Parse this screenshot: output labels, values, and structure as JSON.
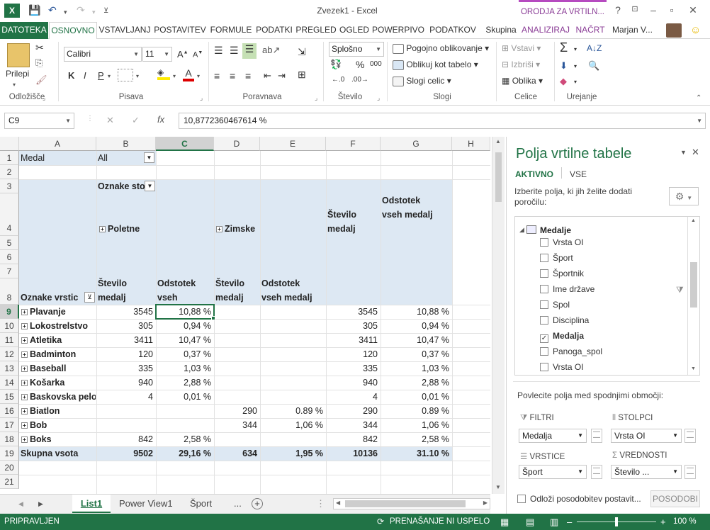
{
  "titlebar": {
    "app_icon": "X",
    "title": "Zvezek1 - Excel",
    "context_tab": "ORODJA ZA VRTILN...",
    "help": "?",
    "minimize": "–",
    "restore": "▫",
    "close": "✕"
  },
  "tabs": [
    "DATOTEKA",
    "OSNOVNO",
    "VSTAVLJANJ",
    "POSTAVITEV",
    "FORMULE",
    "PODATKI",
    "PREGLED",
    "OGLED",
    "POWERPIVO",
    "PODATKOV",
    "Skupina",
    "ANALIZIRAJ",
    "NAČRT"
  ],
  "user": "Marjan V...",
  "ribbon": {
    "clipboard": {
      "paste": "Prilepi",
      "label": "Odložišče"
    },
    "font": {
      "name": "Calibri",
      "size": "11",
      "bold": "K",
      "italic": "I",
      "underline": "P",
      "label": "Pisava"
    },
    "alignment": {
      "label": "Poravnava"
    },
    "number": {
      "format": "Splošno",
      "percent": "%",
      "comma": "000",
      "label": "Število"
    },
    "styles": {
      "cond": "Pogojno oblikovanje",
      "table": "Oblikuj kot tabelo",
      "cell": "Slogi celic",
      "label": "Slogi"
    },
    "cells": {
      "insert": "Vstavi",
      "delete": "Izbriši",
      "format": "Oblika",
      "label": "Celice"
    },
    "editing": {
      "label": "Urejanje"
    }
  },
  "formula_bar": {
    "name_box": "C9",
    "cancel": "✕",
    "enter": "✓",
    "fx": "fx",
    "value": "10,8772360467614 %"
  },
  "columns": [
    "A",
    "B",
    "C",
    "D",
    "E",
    "F",
    "G",
    "H"
  ],
  "rows": [
    "1",
    "2",
    "3",
    "4",
    "5",
    "6",
    "7",
    "8",
    "9",
    "10",
    "11",
    "12",
    "13",
    "14",
    "15",
    "16",
    "17",
    "18",
    "19",
    "20",
    "21"
  ],
  "pivot": {
    "filter_label": "Medal",
    "filter_value": "All",
    "col_labels": "Oznake sto",
    "row_labels": "Oznake vrstic",
    "group1": "Poletne",
    "group2": "Zimske",
    "total_count_hdr_1": "Število",
    "total_count_hdr_2": "medalj",
    "total_pct_hdr_1": "Odstotek",
    "total_pct_hdr_2": "vseh medalj",
    "h_count_1": "Število",
    "h_count_2": "medalj",
    "h_pct_1": "Odstotek",
    "h_pct_2": "vseh",
    "h_count_w1": "Število",
    "h_count_w2": "medalj",
    "h_pct_w1": "Odstotek",
    "h_pct_w2": "vseh medalj",
    "data": [
      {
        "label": "Plavanje",
        "b": "3545",
        "c": "10,88 %",
        "d": "",
        "e": "",
        "f": "3545",
        "g": "10,88 %"
      },
      {
        "label": "Lokostrelstvo",
        "b": "305",
        "c": "0,94 %",
        "d": "",
        "e": "",
        "f": "305",
        "g": "0,94 %"
      },
      {
        "label": "Atletika",
        "b": "3411",
        "c": "10,47 %",
        "d": "",
        "e": "",
        "f": "3411",
        "g": "10,47 %"
      },
      {
        "label": "Badminton",
        "b": "120",
        "c": "0,37 %",
        "d": "",
        "e": "",
        "f": "120",
        "g": "0,37 %"
      },
      {
        "label": "Baseball",
        "b": "335",
        "c": "1,03 %",
        "d": "",
        "e": "",
        "f": "335",
        "g": "1,03 %"
      },
      {
        "label": "Košarka",
        "b": "940",
        "c": "2,88 %",
        "d": "",
        "e": "",
        "f": "940",
        "g": "2,88 %"
      },
      {
        "label": "Baskovska pelota",
        "b": "4",
        "c": "0,01 %",
        "d": "",
        "e": "",
        "f": "4",
        "g": "0,01 %"
      },
      {
        "label": "Biatlon",
        "b": "",
        "c": "",
        "d": "290",
        "e": "0.89 %",
        "f": "290",
        "g": "0.89 %"
      },
      {
        "label": "Bob",
        "b": "",
        "c": "",
        "d": "344",
        "e": "1,06 %",
        "f": "344",
        "g": "1,06 %"
      },
      {
        "label": "Boks",
        "b": "842",
        "c": "2,58 %",
        "d": "",
        "e": "",
        "f": "842",
        "g": "2,58 %"
      }
    ],
    "total": {
      "label": "Skupna vsota",
      "b": "9502",
      "c": "29,16 %",
      "d": "634",
      "e": "1,95 %",
      "f": "10136",
      "g": "31.10 %"
    }
  },
  "sheets": {
    "active": "List1",
    "others": [
      "Power View1",
      "Šport"
    ],
    "more": "...",
    "add": "+"
  },
  "pane": {
    "title": "Polja vrtilne tabele",
    "tab_active": "AKTIVNO",
    "tab_all": "VSE",
    "instructions": "Izberite polja, ki jih želite dodati poročilu:",
    "table_name": "Medalje",
    "fields": [
      {
        "name": "Vrsta OI",
        "checked": false
      },
      {
        "name": "Šport",
        "checked": false
      },
      {
        "name": "Športnik",
        "checked": false
      },
      {
        "name": "Ime države",
        "checked": false
      },
      {
        "name": "Spol",
        "checked": false
      },
      {
        "name": "Disciplina",
        "checked": false
      },
      {
        "name": "Medalja",
        "checked": true
      },
      {
        "name": "Panoga_spol",
        "checked": false
      },
      {
        "name": "Vrsta OI",
        "checked": false
      }
    ],
    "drag_text": "Povlecite polja med spodnjimi območji:",
    "filters_label": "FILTRI",
    "columns_label": "STOLPCI",
    "rows_label": "VRSTICE",
    "values_label": "VREDNOSTI",
    "filters_value": "Medalja",
    "columns_value": "Vrsta OI",
    "rows_value": "Šport",
    "values_value": "Število ...",
    "defer": "Odloži posodobitev postavit...",
    "update": "POSODOBI"
  },
  "status": {
    "ready": "PRIPRAVLJEN",
    "sync": "PRENAŠANJE NI USPELO",
    "zoom": "100 %",
    "minus": "–",
    "plus": "+"
  },
  "colors": {
    "excel_green": "#217346",
    "pivot_band": "#dde8f3",
    "context": "#b64ac0"
  }
}
